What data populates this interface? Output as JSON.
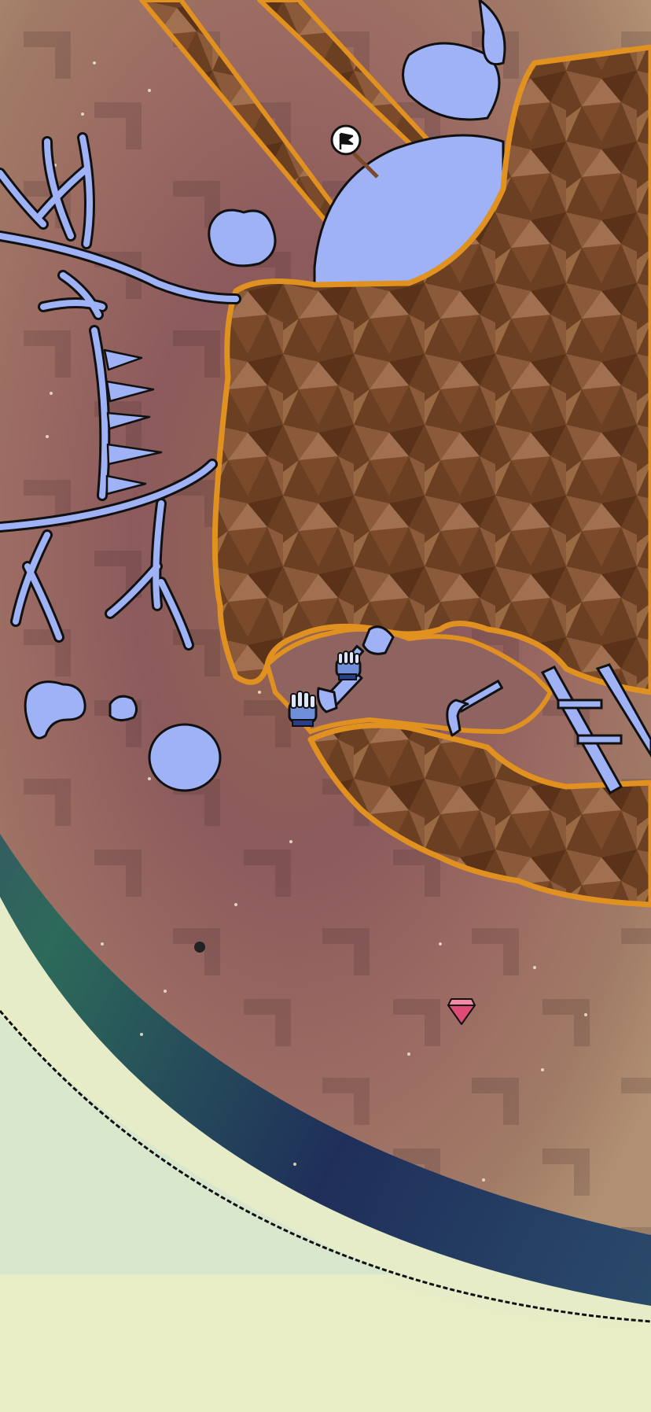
{
  "game": {
    "scene": "underground-dig-level",
    "colors": {
      "planet_fill": "#8a5a55",
      "planet_rim": "#2c2f6a",
      "sky": "#e7ecc9",
      "dirt": "#6b3f22",
      "dirt_border": "#e0911f",
      "ice": "#9fb2f5",
      "outline": "#111111",
      "gem": "#e04b76"
    },
    "icons": {
      "flag": "flag-icon",
      "player": "glove-hand-icon",
      "companion": "glove-hand-icon",
      "shovel": "shovel-icon",
      "pickaxe": "pickaxe-icon",
      "gem": "gem-icon",
      "ladder": "ladder-icon"
    }
  }
}
